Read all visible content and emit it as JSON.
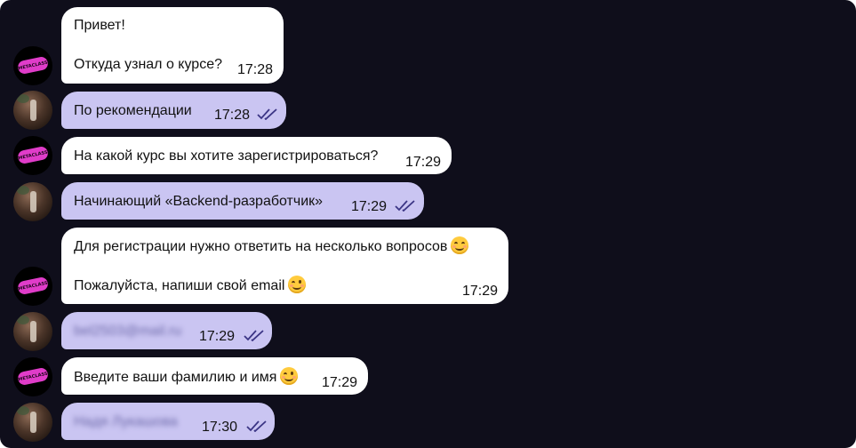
{
  "brand": {
    "avatar_text": "METACLASS",
    "accent_color": "#e03cc9"
  },
  "colors": {
    "background": "#0f0e1b",
    "incoming_bubble": "#ffffff",
    "outgoing_bubble": "#cac5f2"
  },
  "messages": [
    {
      "from": "bot",
      "lines": [
        "Привет!",
        "",
        "Откуда узнал о курсе?"
      ],
      "time": "17:28"
    },
    {
      "from": "user",
      "text": "По рекомендации",
      "time": "17:28",
      "status": "read"
    },
    {
      "from": "bot",
      "text": "На какой курс вы хотите зарегистрироваться?",
      "time": "17:29"
    },
    {
      "from": "user",
      "text": "Начинающий «Backend-разработчик»",
      "time": "17:29",
      "status": "read"
    },
    {
      "from": "bot",
      "lines": [
        "Для регистрации нужно ответить на несколько вопросов",
        "",
        "Пожалуйста, напиши свой email"
      ],
      "emoji": [
        "smiling-face-icon",
        "winking-face-icon"
      ],
      "time": "17:29"
    },
    {
      "from": "user",
      "text": "bel2503@mail.ru",
      "blurred": true,
      "time": "17:29",
      "status": "read"
    },
    {
      "from": "bot",
      "text": "Введите ваши фамилию и имя",
      "emoji": [
        "winking-face-icon"
      ],
      "time": "17:29"
    },
    {
      "from": "user",
      "text": "Надя Лукашова",
      "blurred": true,
      "time": "17:30",
      "status": "read"
    }
  ]
}
